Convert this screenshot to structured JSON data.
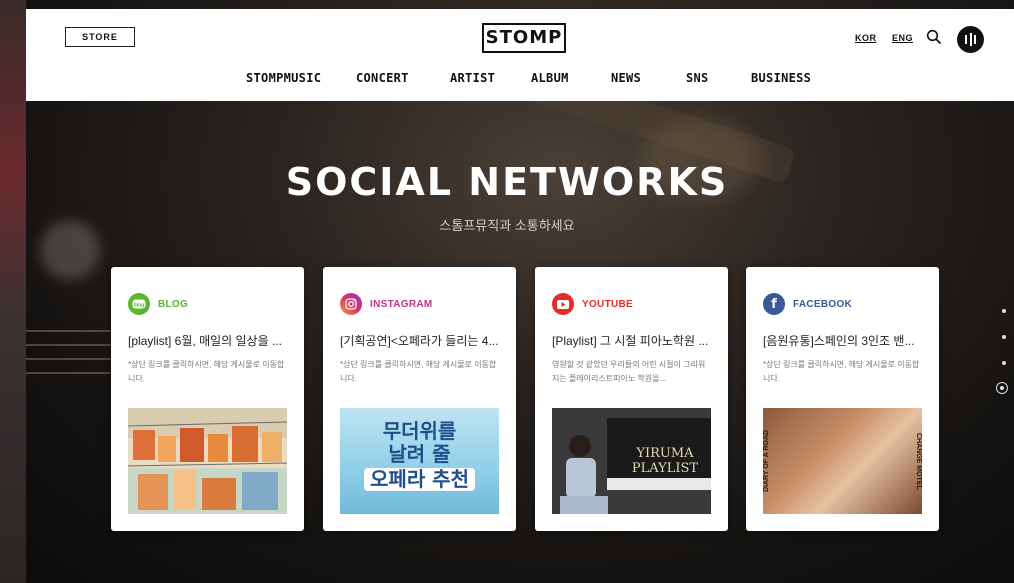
{
  "header": {
    "store_label": "STORE",
    "logo_text": "STOMP",
    "lang_kor": "KOR",
    "lang_eng": "ENG",
    "nav": [
      "STOMPMUSIC",
      "CONCERT",
      "ARTIST",
      "ALBUM",
      "NEWS",
      "SNS",
      "BUSINESS"
    ]
  },
  "hero": {
    "title": "SOCIAL NETWORKS",
    "subtitle": "스톰프뮤직과 소통하세요"
  },
  "cards": [
    {
      "platform": "BLOG",
      "icon": "blog-icon",
      "color": "#5cb531",
      "title": "[playlist] 6월, 매일의 일상을 ...",
      "desc": "*상단 링크를 클릭하시면, 해당 게시물로 이동합니다."
    },
    {
      "platform": "INSTAGRAM",
      "icon": "instagram-icon",
      "color": "#c13584",
      "title": "[기획공연]<오페라가 들리는 4...",
      "desc": "*상단 링크를 클릭하시면, 해당 게시물로 이동합니다.",
      "thumb_text": [
        "무더위를",
        "날려 줄",
        "오페라 추천"
      ]
    },
    {
      "platform": "YOUTUBE",
      "icon": "youtube-icon",
      "color": "#e52d27",
      "title": "[Playlist] 그 시절 피아노학원 ...",
      "desc": "영원할 것 같았던 우리들의 어린 시절이 그리워지는 플레이리스트피아노 학원을...",
      "thumb_text": [
        "YIRUMA",
        "PLAYLIST"
      ]
    },
    {
      "platform": "FACEBOOK",
      "icon": "facebook-icon",
      "color": "#3b5998",
      "title": "[음원유통]스페인의 3인조 밴...",
      "desc": "*상단 링크를 클릭하시면, 해당 게시물로 이동합니다.",
      "thumb_text": [
        "DIARY OF A ROAD",
        "CHANGE MOTEL"
      ]
    }
  ],
  "pagination": {
    "count": 4,
    "active": 4
  }
}
